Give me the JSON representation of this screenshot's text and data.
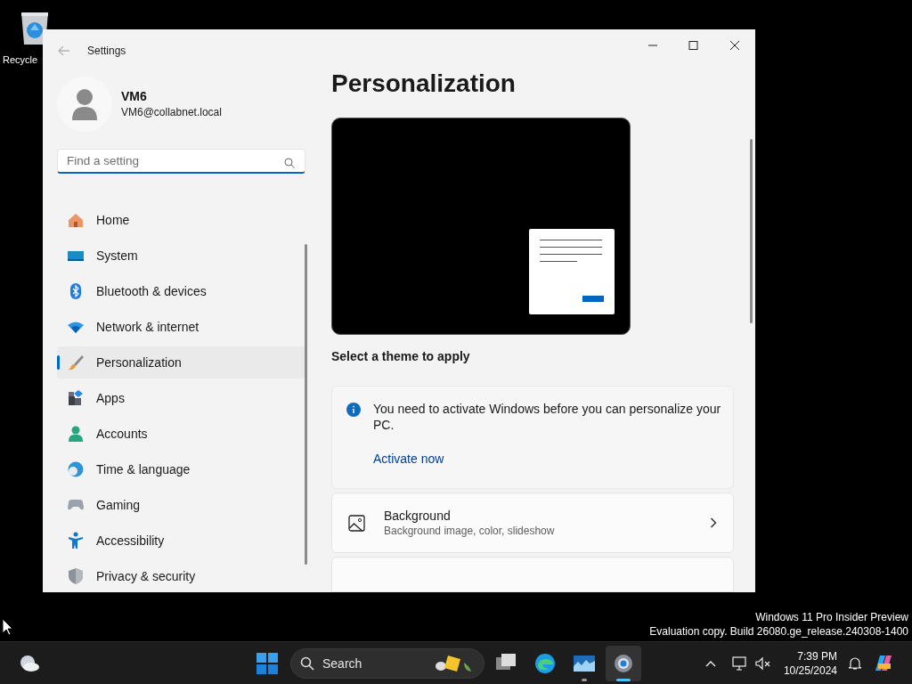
{
  "desktop": {
    "icon_label": "Recycle",
    "system_text": [
      "Windows 11 Pro Insider Preview",
      "Evaluation copy. Build 26080.ge_release.240308-1400"
    ]
  },
  "window": {
    "title": "Settings",
    "user": {
      "name": "VM6",
      "email": "VM6@collabnet.local"
    },
    "search": {
      "placeholder": "Find a setting"
    },
    "nav": [
      {
        "label": "Home",
        "selected": false
      },
      {
        "label": "System",
        "selected": false
      },
      {
        "label": "Bluetooth & devices",
        "selected": false
      },
      {
        "label": "Network & internet",
        "selected": false
      },
      {
        "label": "Personalization",
        "selected": true
      },
      {
        "label": "Apps",
        "selected": false
      },
      {
        "label": "Accounts",
        "selected": false
      },
      {
        "label": "Time & language",
        "selected": false
      },
      {
        "label": "Gaming",
        "selected": false
      },
      {
        "label": "Accessibility",
        "selected": false
      },
      {
        "label": "Privacy & security",
        "selected": false
      }
    ],
    "page_title": "Personalization",
    "theme_caption": "Select a theme to apply",
    "notice": {
      "text": "You need to activate Windows before you can personalize your PC.",
      "link": "Activate now"
    },
    "settings": [
      {
        "title": "Background",
        "subtitle": "Background image, color, slideshow"
      }
    ]
  },
  "taskbar": {
    "search": "Search",
    "apps": [
      {
        "kind": "taskview",
        "running": false,
        "selected": false
      },
      {
        "kind": "edge",
        "running": false,
        "selected": false
      },
      {
        "kind": "monitor",
        "running": true,
        "selected": false
      },
      {
        "kind": "settings",
        "running": true,
        "selected": true
      }
    ],
    "time": "7:39 PM",
    "date": "10/25/2024"
  }
}
